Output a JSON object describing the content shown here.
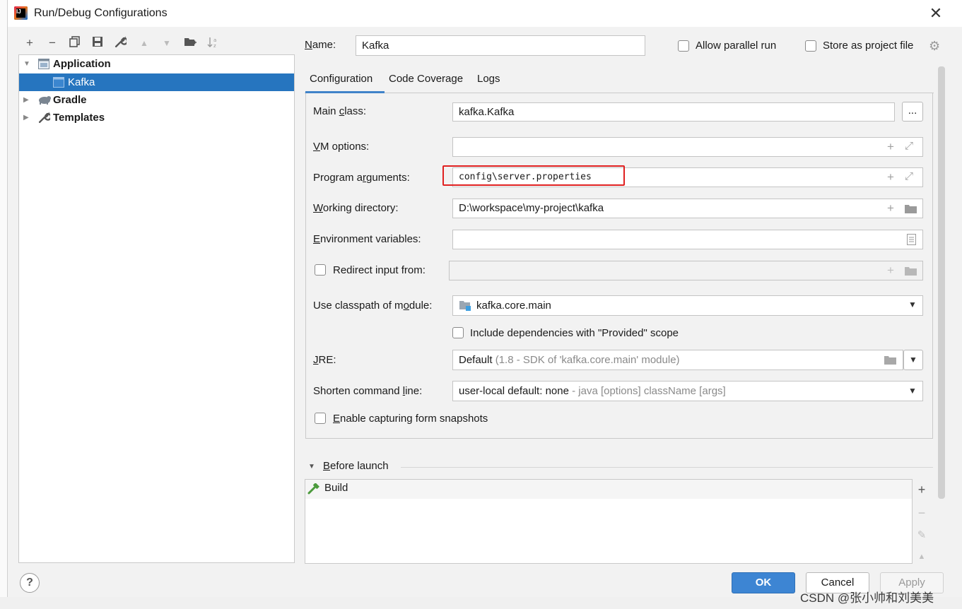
{
  "window": {
    "title": "Run/Debug Configurations",
    "close": "✕"
  },
  "toolbar": {
    "add": "+",
    "remove": "−",
    "copy": "⧉",
    "save": "💾",
    "edit": "🔧",
    "up": "▲",
    "down": "▼",
    "folder": "📁",
    "sort": "↓ª"
  },
  "tree": {
    "items": [
      {
        "label": "Application",
        "expanded": true,
        "bold": true
      },
      {
        "label": "Kafka",
        "selected": true
      },
      {
        "label": "Gradle",
        "bold": true
      },
      {
        "label": "Templates",
        "bold": true
      }
    ]
  },
  "header": {
    "name_label": "Name:",
    "name_value": "Kafka",
    "allow_parallel": "Allow parallel run",
    "store_project": "Store as project file"
  },
  "tabs": [
    "Configuration",
    "Code Coverage",
    "Logs"
  ],
  "form": {
    "main_class_label": "Main class:",
    "main_class_value": "kafka.Kafka",
    "browse": "...",
    "vm_options_label": "VM options:",
    "vm_options_value": "",
    "program_args_label": "Program arguments:",
    "program_args_value": "config\\server.properties",
    "working_dir_label": "Working directory:",
    "working_dir_value": "D:\\workspace\\my-project\\kafka",
    "env_vars_label": "Environment variables:",
    "env_vars_value": "",
    "redirect_label": "Redirect input from:",
    "classpath_label": "Use classpath of module:",
    "classpath_value": "kafka.core.main",
    "include_deps": "Include dependencies with \"Provided\" scope",
    "jre_label": "JRE:",
    "jre_value": "Default",
    "jre_hint": "(1.8 - SDK of 'kafka.core.main' module)",
    "shorten_label": "Shorten command line:",
    "shorten_value": "user-local default: none",
    "shorten_hint": "- java [options] className [args]",
    "snapshots": "Enable capturing form snapshots"
  },
  "before_launch": {
    "title": "Before launch",
    "items": [
      "Build"
    ]
  },
  "buttons": {
    "ok": "OK",
    "cancel": "Cancel",
    "apply": "Apply",
    "help": "?"
  },
  "watermark": "CSDN @张小帅和刘美美",
  "colors": {
    "selection": "#2675bf",
    "ok": "#3d85d3",
    "highlight": "#e02020"
  }
}
